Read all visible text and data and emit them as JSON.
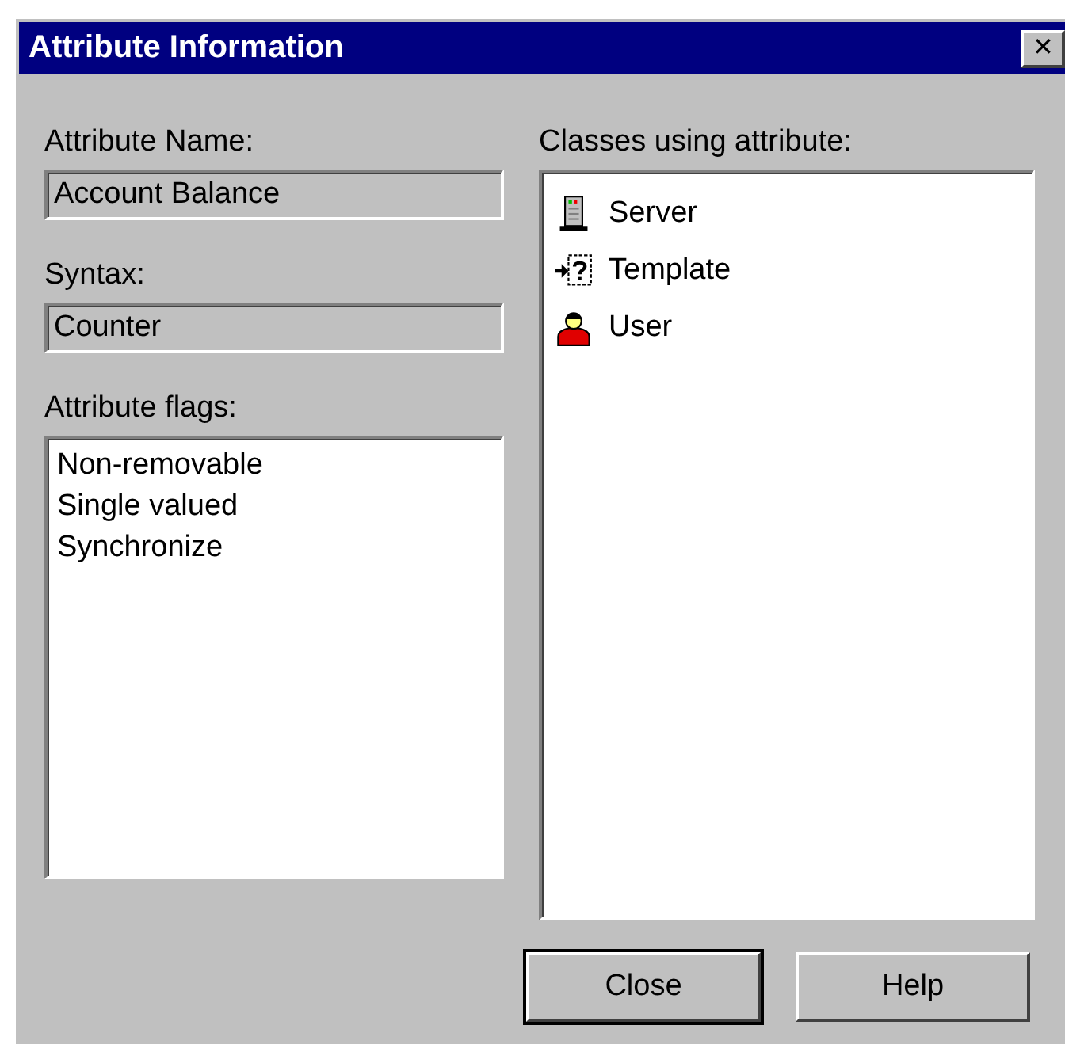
{
  "window": {
    "title": "Attribute Information",
    "close_glyph": "✕"
  },
  "attribute_name": {
    "label": "Attribute Name:",
    "value": "Account Balance"
  },
  "syntax": {
    "label": "Syntax:",
    "value": "Counter"
  },
  "flags": {
    "label": "Attribute flags:",
    "items": [
      "Non-removable",
      "Single valued",
      "Synchronize"
    ]
  },
  "classes": {
    "label": "Classes using attribute:",
    "items": [
      {
        "kind": "server",
        "label": "Server"
      },
      {
        "kind": "template",
        "label": "Template"
      },
      {
        "kind": "user",
        "label": "User"
      }
    ]
  },
  "buttons": [
    {
      "label": "Close",
      "default": true
    },
    {
      "label": "Help",
      "default": false
    }
  ]
}
